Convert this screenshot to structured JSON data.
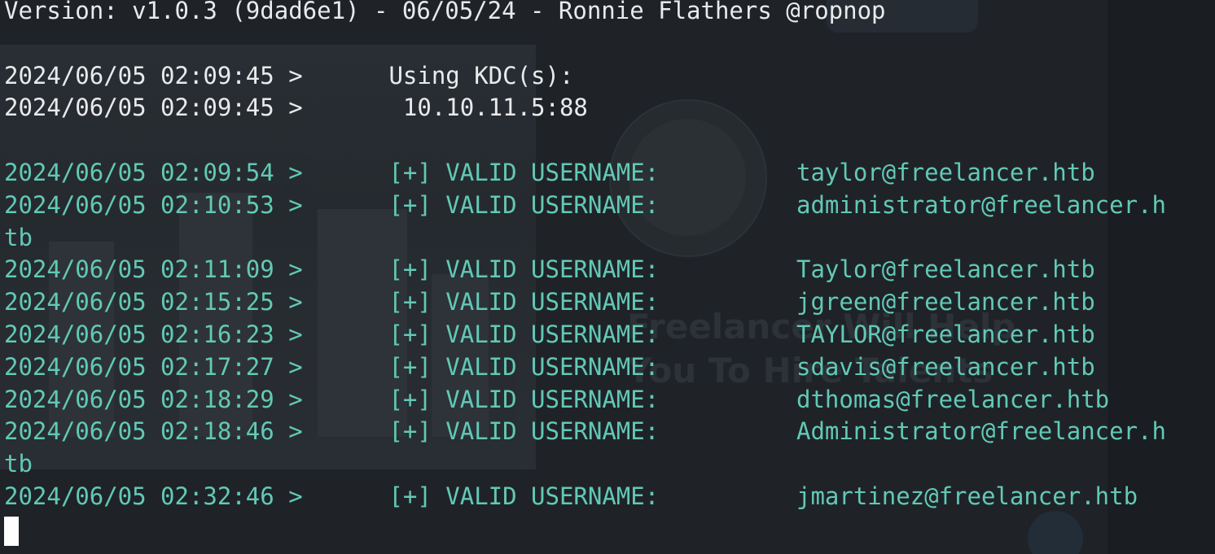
{
  "version_line": "Version: v1.0.3 (9dad6e1) - 06/05/24 - Ronnie Flathers @ropnop",
  "kdc_lines": [
    {
      "timestamp": "2024/06/05 02:09:45 >",
      "text": " Using KDC(s):"
    },
    {
      "timestamp": "2024/06/05 02:09:45 >",
      "text": "  10.10.11.5:88"
    }
  ],
  "results": [
    {
      "timestamp": "2024/06/05 02:09:54 >",
      "message": " [+] VALID USERNAME:",
      "username": "taylor@freelancer.htb",
      "wrap": ""
    },
    {
      "timestamp": "2024/06/05 02:10:53 >",
      "message": " [+] VALID USERNAME:",
      "username": "administrator@freelancer.h",
      "wrap": "tb"
    },
    {
      "timestamp": "2024/06/05 02:11:09 >",
      "message": " [+] VALID USERNAME:",
      "username": "Taylor@freelancer.htb",
      "wrap": ""
    },
    {
      "timestamp": "2024/06/05 02:15:25 >",
      "message": " [+] VALID USERNAME:",
      "username": "jgreen@freelancer.htb",
      "wrap": ""
    },
    {
      "timestamp": "2024/06/05 02:16:23 >",
      "message": " [+] VALID USERNAME:",
      "username": "TAYLOR@freelancer.htb",
      "wrap": ""
    },
    {
      "timestamp": "2024/06/05 02:17:27 >",
      "message": " [+] VALID USERNAME:",
      "username": "sdavis@freelancer.htb",
      "wrap": ""
    },
    {
      "timestamp": "2024/06/05 02:18:29 >",
      "message": " [+] VALID USERNAME:",
      "username": "dthomas@freelancer.htb",
      "wrap": ""
    },
    {
      "timestamp": "2024/06/05 02:18:46 >",
      "message": " [+] VALID USERNAME:",
      "username": "Administrator@freelancer.h",
      "wrap": "tb"
    },
    {
      "timestamp": "2024/06/05 02:32:46 >",
      "message": " [+] VALID USERNAME:",
      "username": "jmartinez@freelancer.htb",
      "wrap": ""
    }
  ],
  "background_text": {
    "headline_1": "Freelancer Will Help",
    "headline_2": "You To Hire Talents"
  },
  "colors": {
    "background": "#1f2328",
    "teal_text": "#62c9b5",
    "white_text": "#e8eaeb"
  }
}
